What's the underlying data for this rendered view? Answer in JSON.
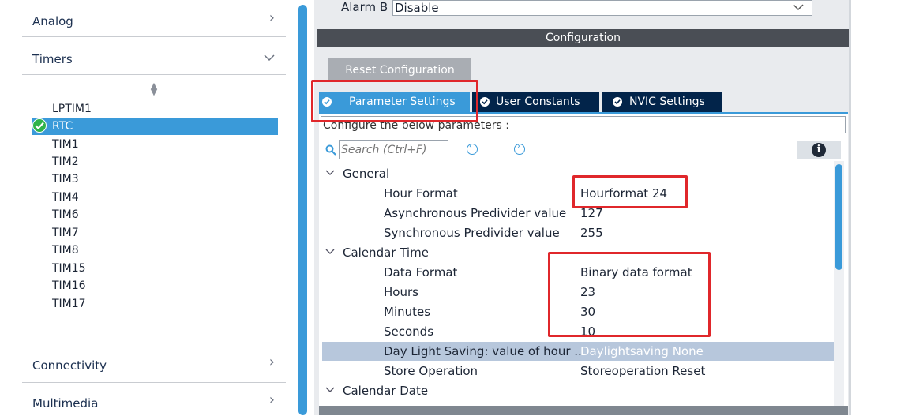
{
  "left": {
    "categories": [
      {
        "label": "Analog",
        "expanded": false
      },
      {
        "label": "Timers",
        "expanded": true
      },
      {
        "label": "Connectivity",
        "expanded": false
      },
      {
        "label": "Multimedia",
        "expanded": false
      }
    ],
    "peripherals": [
      "LPTIM1",
      "RTC",
      "TIM1",
      "TIM2",
      "TIM3",
      "TIM4",
      "TIM6",
      "TIM7",
      "TIM8",
      "TIM15",
      "TIM16",
      "TIM17"
    ],
    "selected_peripheral": "RTC"
  },
  "right": {
    "alarm_label": "Alarm B",
    "alarm_value": "Disable",
    "config_header": "Configuration",
    "reset_button": "Reset Configuration",
    "tabs": [
      {
        "label": "Parameter Settings",
        "active": true
      },
      {
        "label": "User Constants",
        "active": false
      },
      {
        "label": "NVIC Settings",
        "active": false
      }
    ],
    "configure_text": "Configure the below parameters :",
    "search_placeholder": "Search (Ctrl+F)",
    "groups": [
      {
        "name": "General",
        "params": [
          {
            "name": "Hour Format",
            "value": "Hourformat 24"
          },
          {
            "name": "Asynchronous Predivider value",
            "value": "127"
          },
          {
            "name": "Synchronous Predivider value",
            "value": "255"
          }
        ]
      },
      {
        "name": "Calendar Time",
        "params": [
          {
            "name": "Data Format",
            "value": "Binary data format"
          },
          {
            "name": "Hours",
            "value": "23"
          },
          {
            "name": "Minutes",
            "value": "30"
          },
          {
            "name": "Seconds",
            "value": "10"
          },
          {
            "name": "Day Light Saving: value of hour ...",
            "value": "Daylightsaving None"
          },
          {
            "name": "Store Operation",
            "value": "Storeoperation Reset"
          }
        ]
      },
      {
        "name": "Calendar Date",
        "params": []
      }
    ]
  },
  "colors": {
    "accent": "#3a9ad9",
    "tab_dark": "#02244a",
    "highlight": "#e0272b",
    "check_green": "#2fb34a"
  }
}
